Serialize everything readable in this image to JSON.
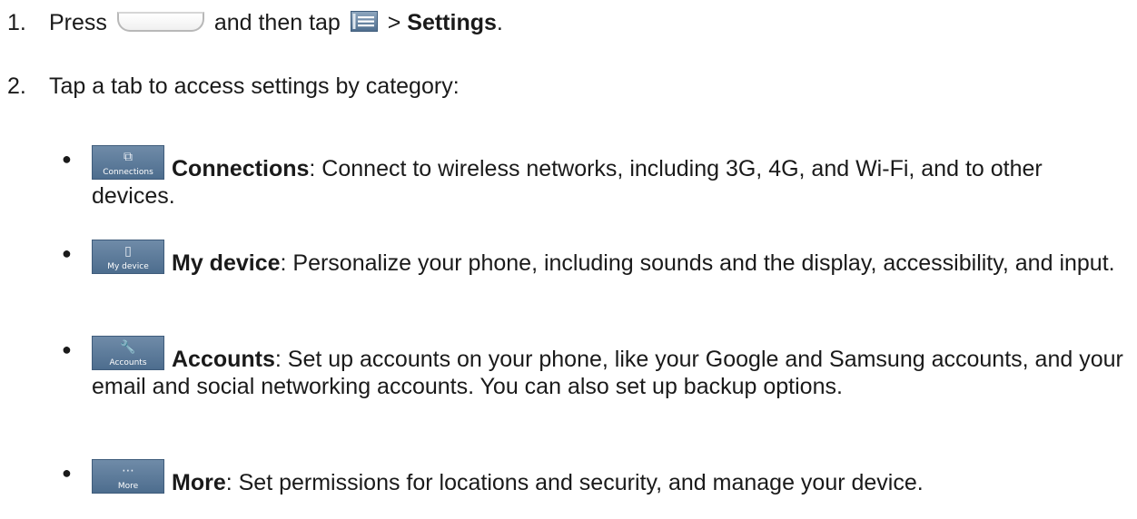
{
  "steps": [
    {
      "number": "1.",
      "text_before": "Press",
      "text_middle": "and then tap",
      "text_after": " > ",
      "bold": "Settings",
      "end": "."
    },
    {
      "number": "2.",
      "text": "Tap a tab to access settings by category:"
    }
  ],
  "icons": {
    "home_key": "home-key-icon",
    "menu_key": "menu-key-icon"
  },
  "categories": [
    {
      "tab_label": "Connections",
      "glyph": "⧉",
      "title": "Connections",
      "description": ": Connect to wireless networks, including 3G, 4G, and Wi-Fi, and to other devices."
    },
    {
      "tab_label": "My device",
      "glyph": "▯",
      "title": "My device",
      "description": ": Personalize your phone, including sounds and the display, accessibility, and input."
    },
    {
      "tab_label": "Accounts",
      "glyph": "🔧",
      "title": "Accounts",
      "description": ": Set up accounts on your phone, like your Google and Samsung accounts, and your email and social networking accounts. You can also set up backup options."
    },
    {
      "tab_label": "More",
      "glyph": "⋯",
      "title": "More",
      "description": ": Set permissions for locations and security, and manage your device."
    }
  ],
  "colors": {
    "tab_icon_bg": "#5b7898",
    "text": "#1a1a1a"
  }
}
